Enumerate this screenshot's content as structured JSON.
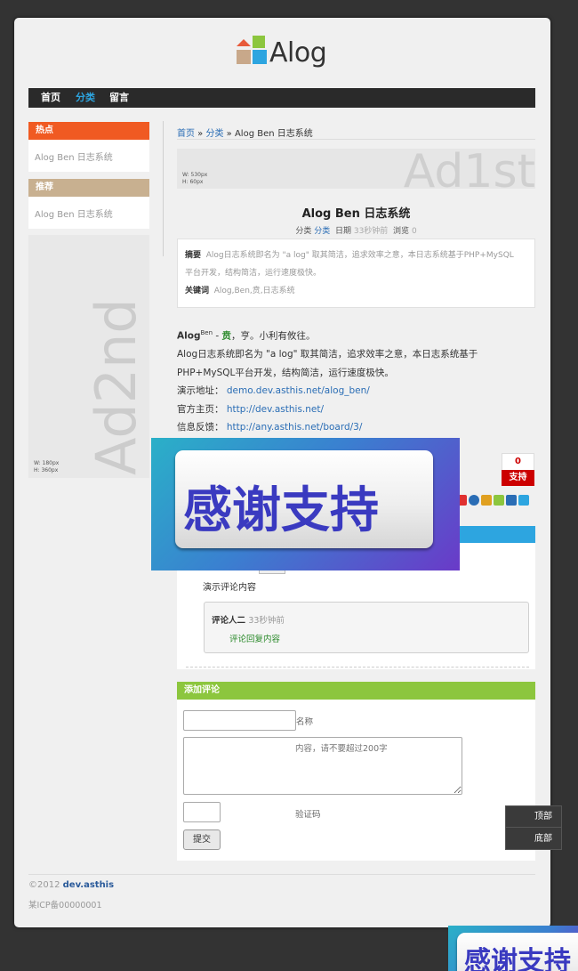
{
  "logo": {
    "text": "Alog",
    "colors": [
      "#e85a3a",
      "#8cc63e",
      "#c8a88a",
      "#2da5e0"
    ]
  },
  "nav": {
    "items": [
      {
        "label": "首页",
        "active": false
      },
      {
        "label": "分类",
        "active": true
      },
      {
        "label": "留言",
        "active": false
      }
    ]
  },
  "sidebar": {
    "hot": {
      "title": "热点",
      "color": "#f05a22",
      "link": "Alog Ben 日志系统"
    },
    "recommend": {
      "title": "推荐",
      "color": "#c8b090",
      "link": "Alog Ben 日志系统"
    }
  },
  "ad2": {
    "text": "Ad2nd",
    "w": "W: 180px",
    "h": "H:  360px"
  },
  "ad1": {
    "text": "Ad1st",
    "w": "W: 530px",
    "h": "H: 60px"
  },
  "breadcrumb": {
    "home": "首页",
    "sep1": " » ",
    "cat": "分类",
    "sep2": " » ",
    "current": "Alog Ben 日志系统"
  },
  "post": {
    "title": "Alog Ben 日志系统",
    "meta": {
      "cat_label": "分类",
      "cat_value": "分类",
      "date_label": "日期",
      "date_value": "33秒钟前",
      "views_label": "浏览",
      "views_value": "0"
    },
    "summary_label": "摘要",
    "summary_line1": "Alog日志系统即名为 \"a log\" 取其简洁，追求效率之意，本日志系统基于PHP+MySQL",
    "summary_line2": "平台开发，结构简洁，运行速度极快。",
    "keywords_label": "关键词",
    "keywords": "Alog,Ben,贲,日志系统",
    "body": {
      "brand": "Alog",
      "sup": "Ben",
      "dash": " - ",
      "ben": "贲",
      "motto": "，亨。小利有攸往。",
      "line2": "Alog日志系统即名为 \"a log\" 取其简洁，追求效率之意，本日志系统基于",
      "line3": "PHP+MySQL平台开发，结构简洁，运行速度极快。",
      "demo_label": "演示地址：",
      "demo_link": "demo.dev.asthis.net/alog_ben/",
      "home_label": "官方主页：",
      "home_link": "http://dev.asthis.net/",
      "feedback_label": "信息反馈：",
      "feedback_link": "http://any.asthis.net/board/3/"
    }
  },
  "vote": {
    "count": "0",
    "button": "支持"
  },
  "share_colors": [
    "#e03030",
    "#2a6db5",
    "#e0a020",
    "#8cc63e",
    "#2a6db5",
    "#2da5e0"
  ],
  "comments": {
    "demo_text": "演示评论内容",
    "reply_author": "评论人二",
    "reply_time": "33秒钟前",
    "reply_text": "评论回复内容"
  },
  "add_comment": {
    "title": "添加评论",
    "name_label": "名称",
    "content_placeholder": "内容，请不要超过200字",
    "captcha_label": "验证码",
    "submit": "提交"
  },
  "footer": {
    "copyright": "©2012",
    "site": "dev.asthis",
    "icp": "某ICP备00000001"
  },
  "float": {
    "top": "顶部",
    "bottom": "底部"
  },
  "thanks_banner": {
    "text": "感谢支持"
  }
}
